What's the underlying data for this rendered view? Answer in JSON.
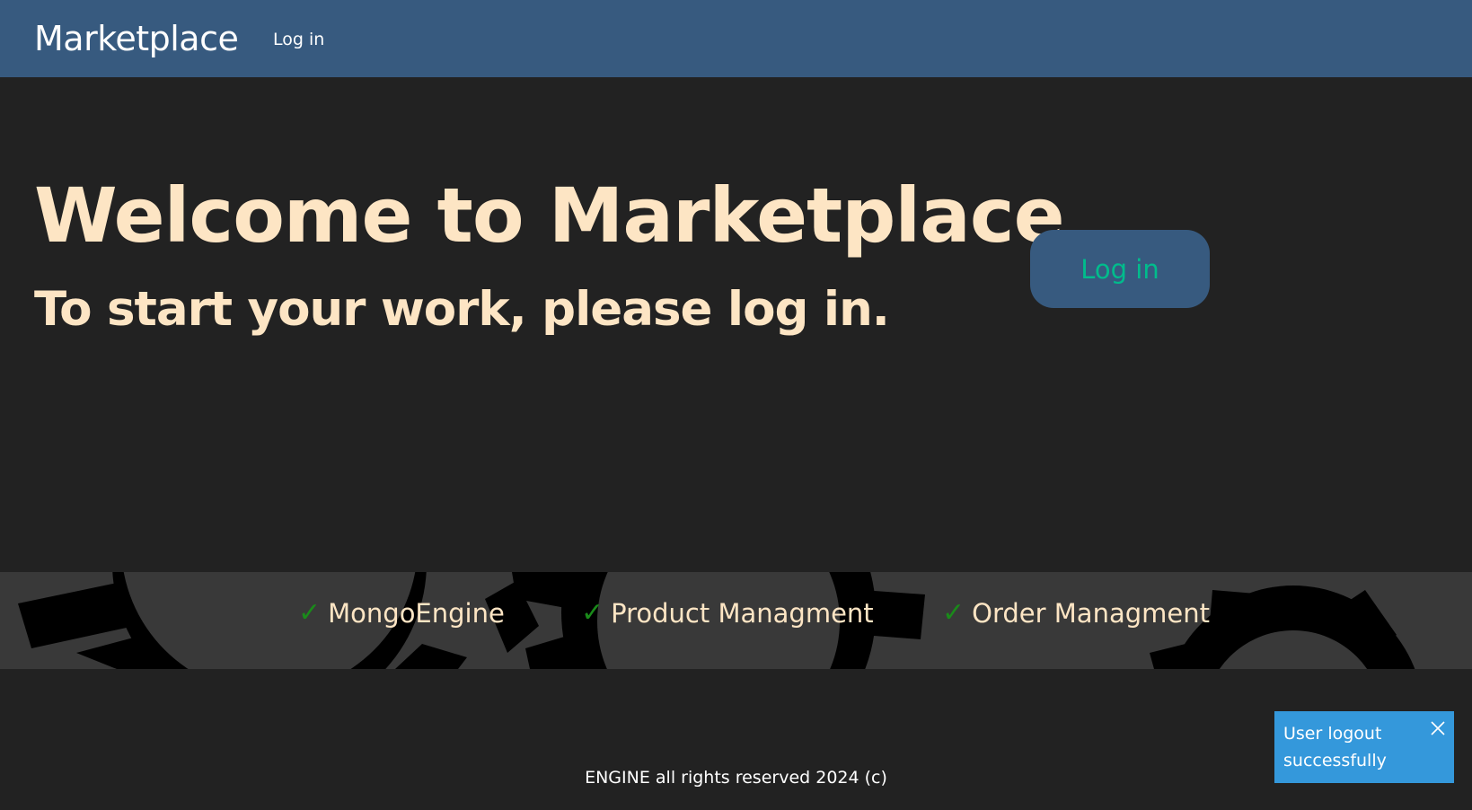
{
  "navbar": {
    "brand": "Marketplace",
    "links": {
      "login": "Log in"
    },
    "background": "#375a7f"
  },
  "hero": {
    "title": "Welcome to Marketplace",
    "subtitle": "To start your work, please log in.",
    "login_button": "Log in",
    "text_color": "#fde5c4",
    "button_text_color": "#00bc8c"
  },
  "features": {
    "check_icon": "check-icon",
    "items": [
      {
        "label": "MongoEngine"
      },
      {
        "label": "Product Managment"
      },
      {
        "label": "Order Managment"
      }
    ]
  },
  "footer": {
    "text": "ENGINE all rights reserved 2024 (c)"
  },
  "toast": {
    "message_line1": "User logout",
    "message_line2": "successfully",
    "close_icon": "close-icon",
    "background": "#3498db"
  }
}
